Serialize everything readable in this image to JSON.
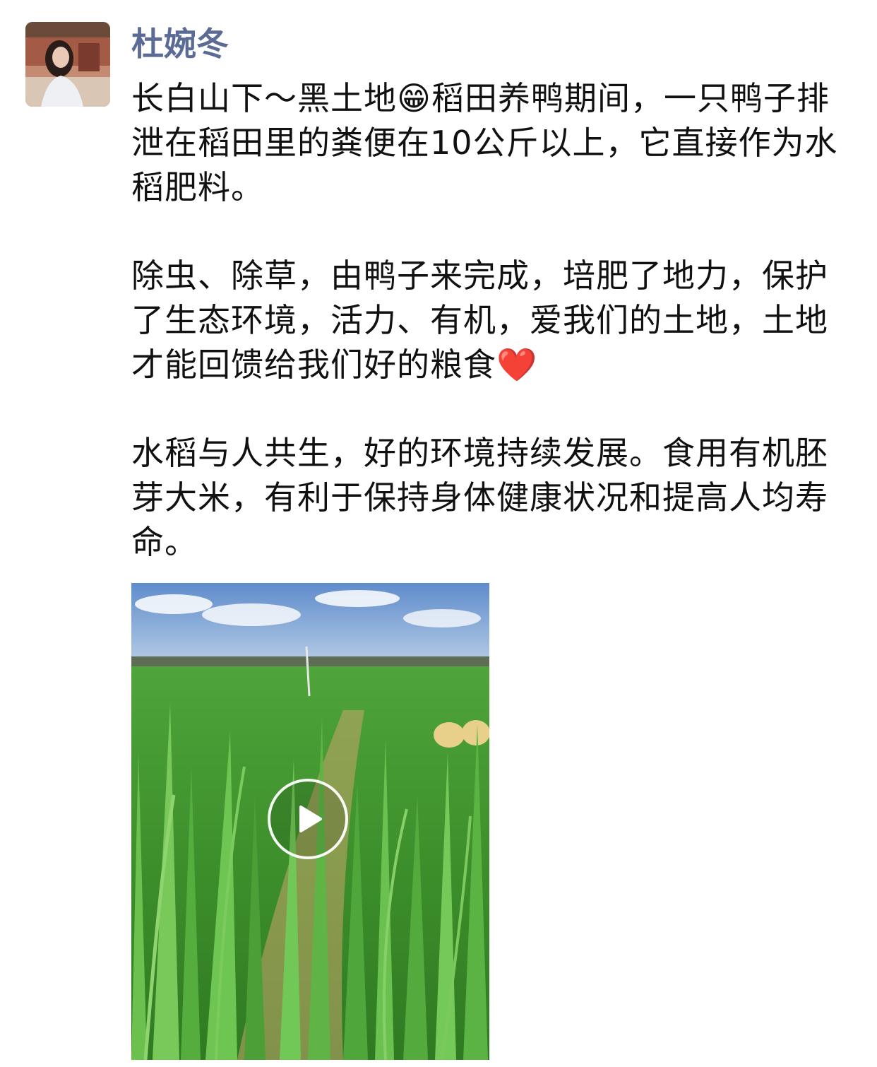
{
  "post": {
    "author": "杜婉冬",
    "paragraphs": [
      [
        "长白山下～黑土地",
        "😁",
        "稻田养鸭期间，一只鸭子排泄在稻田里的粪便在10公斤以上，它直接作为水稻肥料。"
      ],
      [
        "除虫、除草，由鸭子来完成，培肥了地力，保护了生态环境，活力、有机，爱我们的土地，土地才能回馈给我们好的粮食",
        "❤️",
        ""
      ],
      [
        "水稻与人共生，好的环境持续发展。食用有机胚芽大米，有利于保持身体健康状况和提高人均寿命。",
        "",
        ""
      ]
    ]
  },
  "video": {
    "icon": "play-icon"
  }
}
